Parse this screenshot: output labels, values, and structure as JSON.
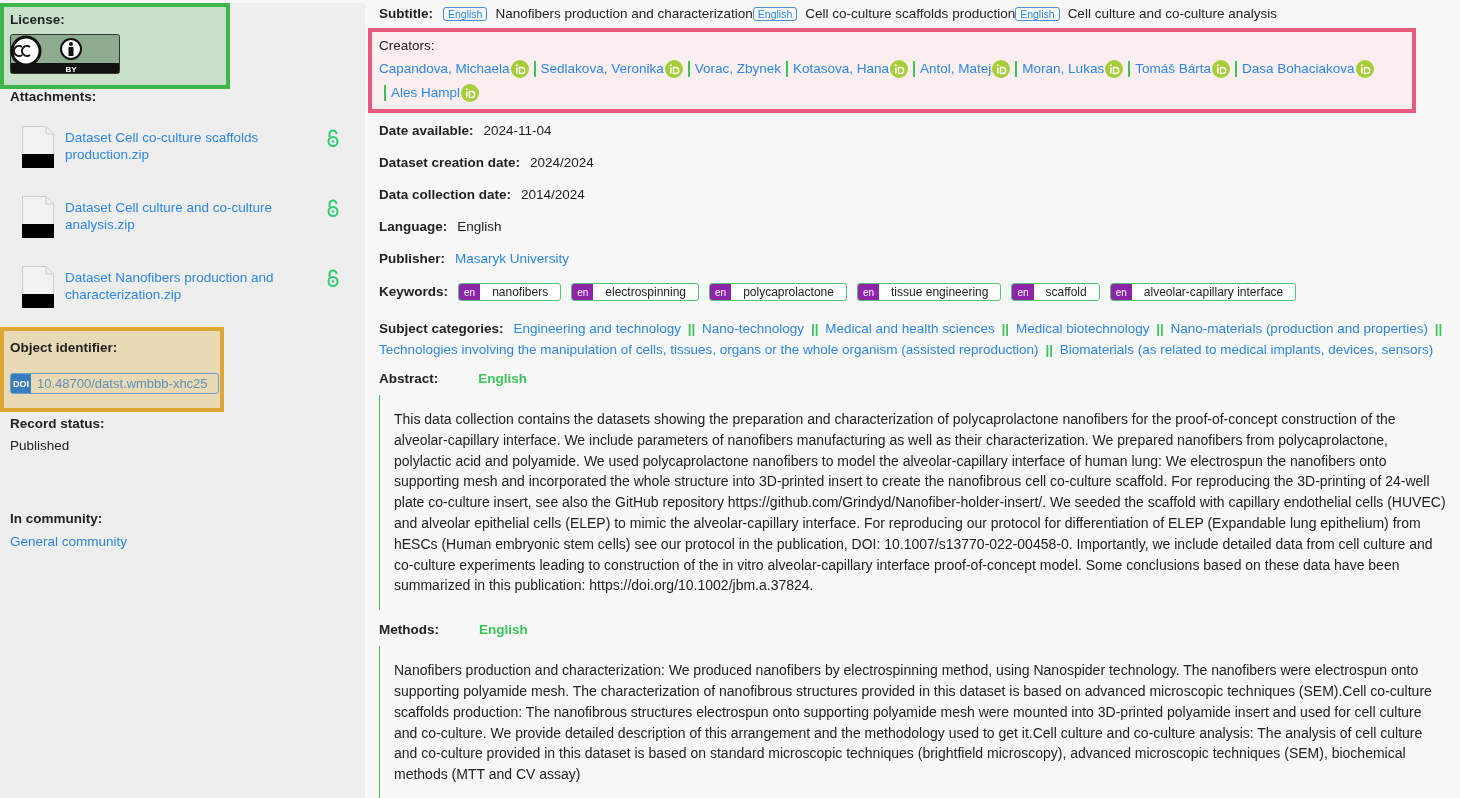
{
  "sidebar": {
    "license": {
      "label": "License:",
      "highlighted": true,
      "badge_text": "BY"
    },
    "attachments": {
      "label": "Attachments:",
      "items": [
        {
          "name": "Dataset Cell co-culture scaffolds production.zip",
          "open_access": true
        },
        {
          "name": "Dataset Cell culture and co-culture analysis.zip",
          "open_access": true
        },
        {
          "name": "Dataset Nanofibers production and characterization.zip",
          "open_access": true
        }
      ]
    },
    "identifier": {
      "label": "Object identifier:",
      "highlighted": true,
      "scheme": "DOI",
      "value": "10.48700/datst.wmbbb-xhc25"
    },
    "record_status": {
      "label": "Record status:",
      "value": "Published"
    },
    "community": {
      "label": "In community:",
      "value": "General community"
    }
  },
  "main": {
    "subtitle": {
      "label": "Subtitle:",
      "entries": [
        {
          "lang": "English",
          "text": "Nanofibers production and characterization"
        },
        {
          "lang": "English",
          "text": "Cell co-culture scaffolds production"
        },
        {
          "lang": "English",
          "text": "Cell culture and co-culture analysis"
        }
      ]
    },
    "creators": {
      "label": "Creators:",
      "highlighted": true,
      "items": [
        {
          "name": "Capandova, Michaela",
          "orcid": true
        },
        {
          "name": "Sedlakova, Veronika",
          "orcid": true
        },
        {
          "name": "Vorac, Zbynek",
          "orcid": false
        },
        {
          "name": "Kotasova, Hana",
          "orcid": true
        },
        {
          "name": "Antol, Matej",
          "orcid": true
        },
        {
          "name": "Moran, Lukas",
          "orcid": true
        },
        {
          "name": "Tomáš Bárta",
          "orcid": true
        },
        {
          "name": "Dasa Bohaciakova",
          "orcid": true
        },
        {
          "name": "Ales Hampl",
          "orcid": true
        }
      ]
    },
    "fields": [
      {
        "label": "Date available:",
        "value": "2024-11-04",
        "kind": "text"
      },
      {
        "label": "Dataset creation date:",
        "value": "2024/2024",
        "kind": "text"
      },
      {
        "label": "Data collection date:",
        "value": "2014/2024",
        "kind": "text"
      },
      {
        "label": "Language:",
        "value": "English",
        "kind": "text"
      },
      {
        "label": "Publisher:",
        "value": "Masaryk University",
        "kind": "link"
      }
    ],
    "keywords": {
      "label": "Keywords:",
      "items": [
        {
          "lang": "en",
          "text": "nanofibers"
        },
        {
          "lang": "en",
          "text": "electrospinning"
        },
        {
          "lang": "en",
          "text": "polycaprolactone"
        },
        {
          "lang": "en",
          "text": "tissue engineering"
        },
        {
          "lang": "en",
          "text": "scaffold"
        },
        {
          "lang": "en",
          "text": "alveolar-capillary interface"
        }
      ]
    },
    "subjects": {
      "label": "Subject categories:",
      "separator": "||",
      "items": [
        "Engineering and technology",
        "Nano-technology",
        "Medical and health sciences",
        "Medical biotechnology",
        "Nano-materials (production and properties)",
        "Technologies involving the manipulation of cells, tissues, organs or the whole organism (assisted reproduction)",
        "Biomaterials (as related to medical implants, devices, sensors)"
      ]
    },
    "abstract": {
      "label": "Abstract:",
      "lang": "English",
      "text": "This data collection contains the datasets showing the preparation and characterization of polycaprolactone nanofibers for the proof-of-concept construction of the alveolar-capillary interface. We include parameters of nanofibers manufacturing as well as their characterization. We prepared nanofibers from polycaprolactone, polylactic acid and polyamide. We used polycaprolactone nanofibers to model the alveolar-capillary interface of human lung: We electrospun the nanofibers onto supporting mesh and incorporated the whole structure into 3D-printed insert to create the nanofibrous cell co-culture scaffold. For reproducing the 3D-printing of 24-well plate co-culture insert, see also the GitHub repository https://github.com/Grindyd/Nanofiber-holder-insert/. We seeded the scaffold with capillary endothelial cells (HUVEC) and alveolar epithelial cells (ELEP) to mimic the alveolar-capillary interface. For reproducing our protocol for differentiation of ELEP (Expandable lung epithelium) from hESCs (Human embryonic stem cells) see our protocol in the publication, DOI: 10.1007/s13770-022-00458-0. Importantly, we include detailed data from cell culture and co-culture experiments leading to construction of the in vitro alveolar-capillary interface proof-of-concept model. Some conclusions based on these data have been summarized in this publication: https://doi.org/10.1002/jbm.a.37824."
    },
    "methods": {
      "label": "Methods:",
      "lang": "English",
      "text": "Nanofibers production and characterization: We produced nanofibers by electrospinning method, using Nanospider technology. The nanofibers were electrospun onto supporting polyamide mesh. The characterization of nanofibrous structures provided in this dataset is based on advanced microscopic techniques (SEM).Cell co-culture scaffolds production: The nanofibrous structures electrospun onto supporting polyamide mesh were mounted into 3D-printed polyamide insert and used for cell culture and co-culture. We provide detailed description of this arrangement and the methodology used to get it.Cell culture and co-culture analysis: The analysis of cell culture and co-culture provided in this dataset is based on standard microscopic techniques (brightfield microscopy), advanced microscopic techniques (SEM), biochemical methods (MTT and CV assay)"
    }
  }
}
